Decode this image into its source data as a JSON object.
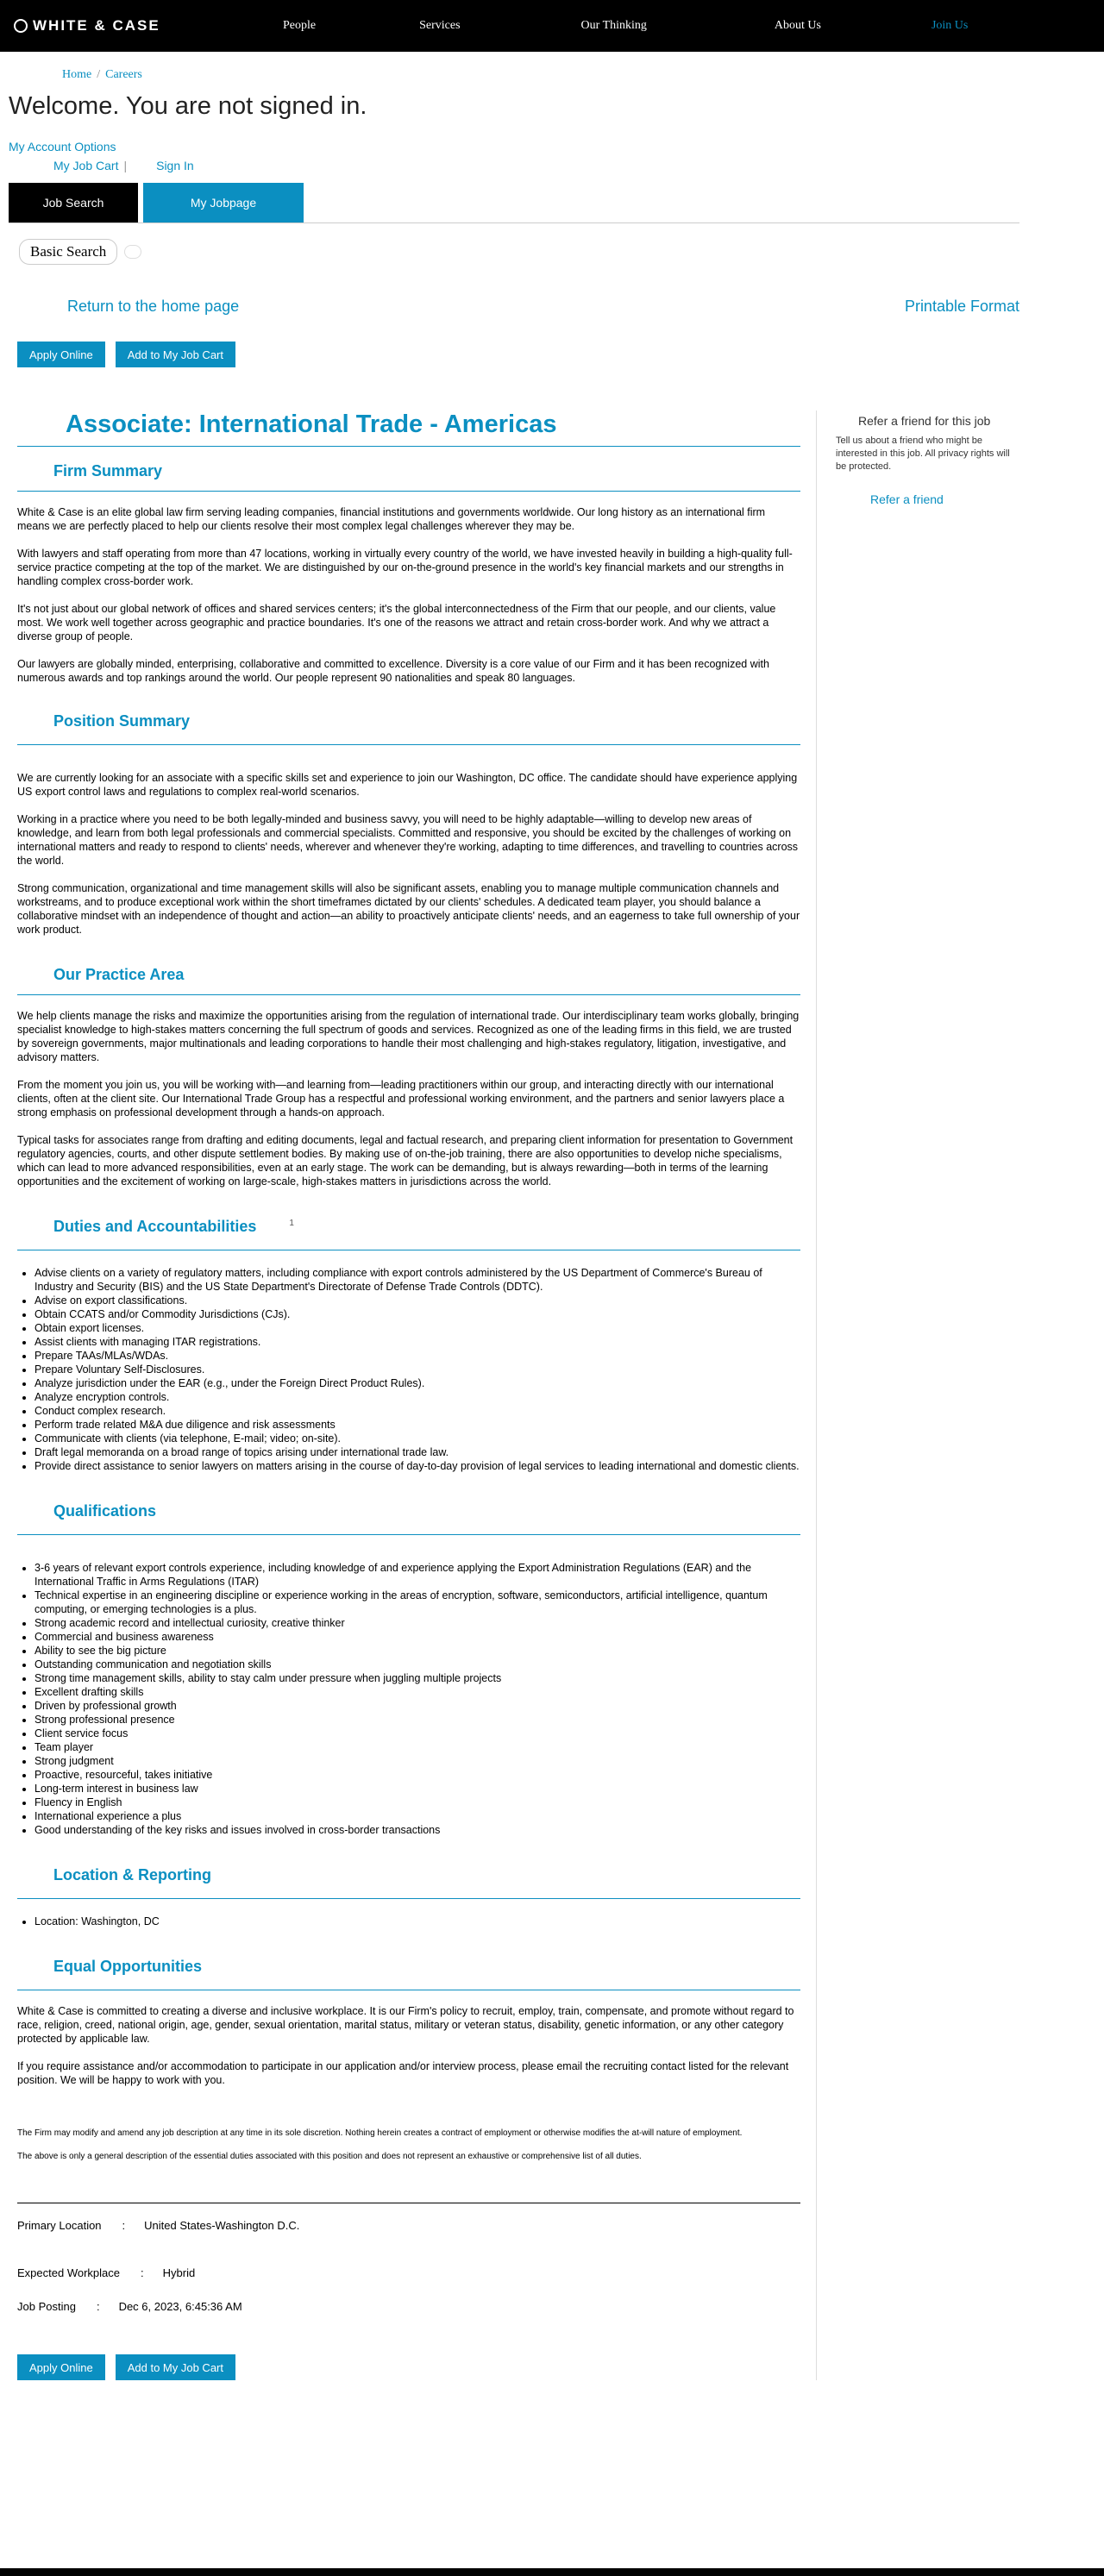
{
  "header": {
    "logo": "WHITE & CASE",
    "nav": [
      "People",
      "Services",
      "Our Thinking",
      "About Us",
      "Join Us"
    ]
  },
  "breadcrumb": {
    "home": "Home",
    "careers": "Careers"
  },
  "welcome": "Welcome. You are not signed in.",
  "account": {
    "options": "My Account Options",
    "job_cart": "My Job Cart",
    "sign_in": "Sign In"
  },
  "tabs": {
    "job_search": "Job Search",
    "my_jobpage": "My Jobpage"
  },
  "subtab": {
    "basic_search": "Basic Search"
  },
  "utility": {
    "return_home": "Return to the home page",
    "printable": "Printable Format"
  },
  "buttons": {
    "apply": "Apply Online",
    "add_cart": "Add to My Job Cart"
  },
  "sidebar": {
    "title": "Refer a friend for this job",
    "desc": "Tell us about a friend who might be interested in this job. All privacy rights will be protected.",
    "link": "Refer a friend"
  },
  "job": {
    "title": "Associate: International Trade - Americas",
    "firm_summary": {
      "heading": "Firm Summary",
      "paras": [
        "White & Case is an elite global law firm serving leading companies, financial institutions and governments worldwide. Our long history as an international firm means we are perfectly placed to help our clients resolve their most complex legal challenges wherever they may be.",
        "With lawyers and staff operating from more than 47 locations, working in virtually every country of the world, we have invested heavily in building a high-quality full-service practice competing at the top of the market. We are distinguished by our on-the-ground presence in the world's key financial markets and our strengths in handling complex cross-border work.",
        "It's not just about our global network of offices and shared services centers; it's the global interconnectedness of the Firm that our people, and our clients, value most. We work well together across geographic and practice boundaries. It's one of the reasons we attract and retain cross-border work. And why we attract a diverse group of people.",
        "Our lawyers are globally minded, enterprising, collaborative and committed to excellence. Diversity is a core value of our Firm and it has been recognized with numerous awards and top rankings around the world. Our people represent 90 nationalities and speak 80 languages."
      ]
    },
    "position_summary": {
      "heading": "Position Summary",
      "paras": [
        "We are currently looking for an associate with a specific skills set and experience to join our Washington, DC office. The candidate should have experience applying US export control laws and regulations to complex real-world scenarios.",
        "Working in a practice where you need to be both legally-minded and business savvy, you will need to be highly adaptable—willing to develop new areas of knowledge, and learn from both legal professionals and commercial specialists. Committed and responsive, you should be excited by the challenges of working on international matters and ready to respond to clients' needs, wherever and whenever they're working, adapting to time differences, and travelling to countries across the world.",
        "Strong communication, organizational and time management skills will also be significant assets, enabling you to manage multiple communication channels and workstreams, and to produce exceptional work within the short timeframes dictated by our clients' schedules. A dedicated team player, you should balance a collaborative mindset with an independence of thought and action—an ability to proactively anticipate clients' needs, and an eagerness to take full ownership of your work product."
      ]
    },
    "practice_area": {
      "heading": "Our Practice Area",
      "paras": [
        "We help clients manage the risks and maximize the opportunities arising from the regulation of international trade. Our interdisciplinary team works globally, bringing specialist knowledge to high-stakes matters concerning the full spectrum of goods and services. Recognized as one of the leading firms in this field, we are trusted by sovereign governments, major multinationals and leading corporations to handle their most challenging and high-stakes regulatory, litigation, investigative,  and advisory matters.",
        "From the moment you join us, you will be working with—and learning from—leading practitioners within our group, and interacting directly with our international clients, often at the client site. Our International Trade Group has a respectful and professional working environment, and the partners and senior lawyers place a strong emphasis on professional development through a hands-on approach.",
        "Typical tasks for associates range from drafting and editing documents, legal and factual research, and preparing client information for presentation to Government regulatory agencies, courts, and other dispute settlement bodies. By making use of on-the-job training, there are also opportunities to develop niche specialisms, which can lead to more advanced responsibilities, even at an early stage. The work can be demanding, but is always rewarding—both in terms of the learning opportunities and the excitement of working on large-scale, high-stakes matters in jurisdictions across the world."
      ]
    },
    "duties": {
      "heading": "Duties and Accountabilities",
      "marker": "1",
      "items": [
        "Advise clients on a variety of regulatory matters, including compliance with export controls administered by the US Department of Commerce's Bureau of Industry and Security (BIS) and the US State Department's Directorate of Defense Trade Controls (DDTC).",
        "Advise on export classifications.",
        "Obtain CCATS and/or Commodity Jurisdictions (CJs).",
        "Obtain export licenses.",
        "Assist clients with managing ITAR registrations.",
        "Prepare TAAs/MLAs/WDAs.",
        "Prepare Voluntary Self-Disclosures.",
        "Analyze jurisdiction under the EAR (e.g., under the Foreign Direct Product Rules).",
        "Analyze encryption controls.",
        "Conduct complex research.",
        "Perform trade related M&A due diligence and risk assessments",
        "Communicate with clients (via telephone, E-mail; video; on-site).",
        "Draft legal memoranda on a broad range of topics arising under international trade law.",
        "Provide direct assistance to senior lawyers on matters arising in the course of day-to-day provision of legal services to leading international and domestic clients."
      ]
    },
    "qualifications": {
      "heading": "Qualifications",
      "items": [
        "3-6 years of relevant export controls experience, including knowledge of and experience applying the Export Administration Regulations (EAR) and the International Traffic in Arms Regulations (ITAR)",
        "Technical expertise in an engineering discipline or experience working in the areas of encryption, software, semiconductors, artificial intelligence, quantum computing, or emerging technologies is a plus.",
        "Strong academic record and intellectual curiosity, creative thinker",
        "Commercial and business awareness",
        "Ability to see the big picture",
        "Outstanding communication and negotiation skills",
        "Strong time management skills, ability to stay calm under pressure when juggling multiple projects",
        "Excellent drafting skills",
        "Driven by professional growth",
        "Strong professional presence",
        "Client service focus",
        "Team player",
        "Strong judgment",
        "Proactive, resourceful, takes initiative",
        "Long-term interest in business law",
        "Fluency in English",
        "International experience a plus",
        "Good understanding of the key risks and issues involved in cross-border transactions"
      ]
    },
    "location": {
      "heading": "Location & Reporting",
      "items": [
        "Location: Washington, DC"
      ]
    },
    "equal": {
      "heading": "Equal Opportunities",
      "paras": [
        "White & Case is committed to creating a diverse and inclusive workplace.  It is our Firm's policy to recruit, employ, train, compensate, and promote without regard to race, religion, creed, national origin, age, gender, sexual orientation, marital status, military or veteran status, disability, genetic information, or any other category protected by applicable law.",
        "If you require assistance and/or accommodation to participate in our application and/or interview process, please email the recruiting contact listed for the relevant position. We will be happy to work with you."
      ]
    },
    "disclaimers": [
      "The Firm may modify and amend any job description at any time in its sole discretion. Nothing herein creates a contract of employment or otherwise modifies the at-will nature of employment.",
      "The above is only a general description of the essential duties associated with this position and does not represent an exhaustive or comprehensive list of all duties."
    ],
    "meta": {
      "primary_location_label": "Primary Location",
      "primary_location_value": "United States-Washington D.C.",
      "workplace_label": "Expected Workplace",
      "workplace_value": "Hybrid",
      "posting_label": "Job Posting",
      "posting_value": "Dec 6, 2023, 6:45:36 AM",
      "separator": ":"
    }
  },
  "colors": {
    "accent": "#0b8fc1",
    "topbar": "#000000"
  }
}
